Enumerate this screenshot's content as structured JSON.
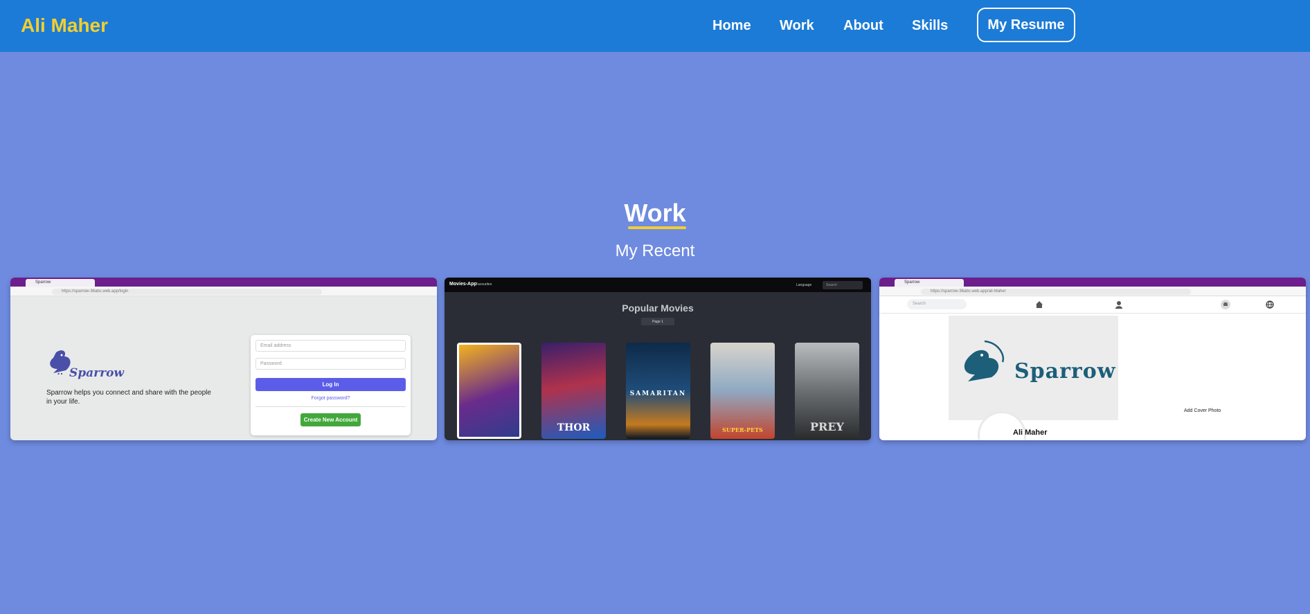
{
  "header": {
    "brand": "Ali Maher",
    "nav": [
      "Home",
      "Work",
      "About",
      "Skills"
    ],
    "resume_button": "My Resume"
  },
  "section": {
    "title": "Work",
    "subtitle": "My Recent"
  },
  "projects": [
    {
      "name": "Sparrow",
      "tab_title": "Sparrow",
      "url": "https://sparrow-36abc.web.app/login",
      "tagline": "Sparrow helps you connect and share with the people in your life.",
      "email_placeholder": "Email address",
      "password_placeholder": "Password",
      "login_label": "Log In",
      "forgot_label": "Forgot password?",
      "create_label": "Create New Account"
    },
    {
      "brand": "Movies-App",
      "favorites": "Favourites",
      "language": "Language",
      "search_placeholder": "Search",
      "heading": "Popular Movies",
      "pager": "Page 1",
      "posters": [
        "",
        "THOR",
        "SAMARITAN",
        "SUPER-PETS",
        "PREY"
      ]
    },
    {
      "tab_title": "Sparrow",
      "url": "https://sparrow-36abc.web.app/ali-Maher",
      "search_placeholder": "Search",
      "logo": "Sparrow",
      "add_cover": "Add Cover Photo",
      "profile_name": "Ali Maher"
    }
  ],
  "colors": {
    "page_bg": "#6f8be0",
    "header_bg": "#1c7bd6",
    "accent": "#f2cf2e"
  }
}
